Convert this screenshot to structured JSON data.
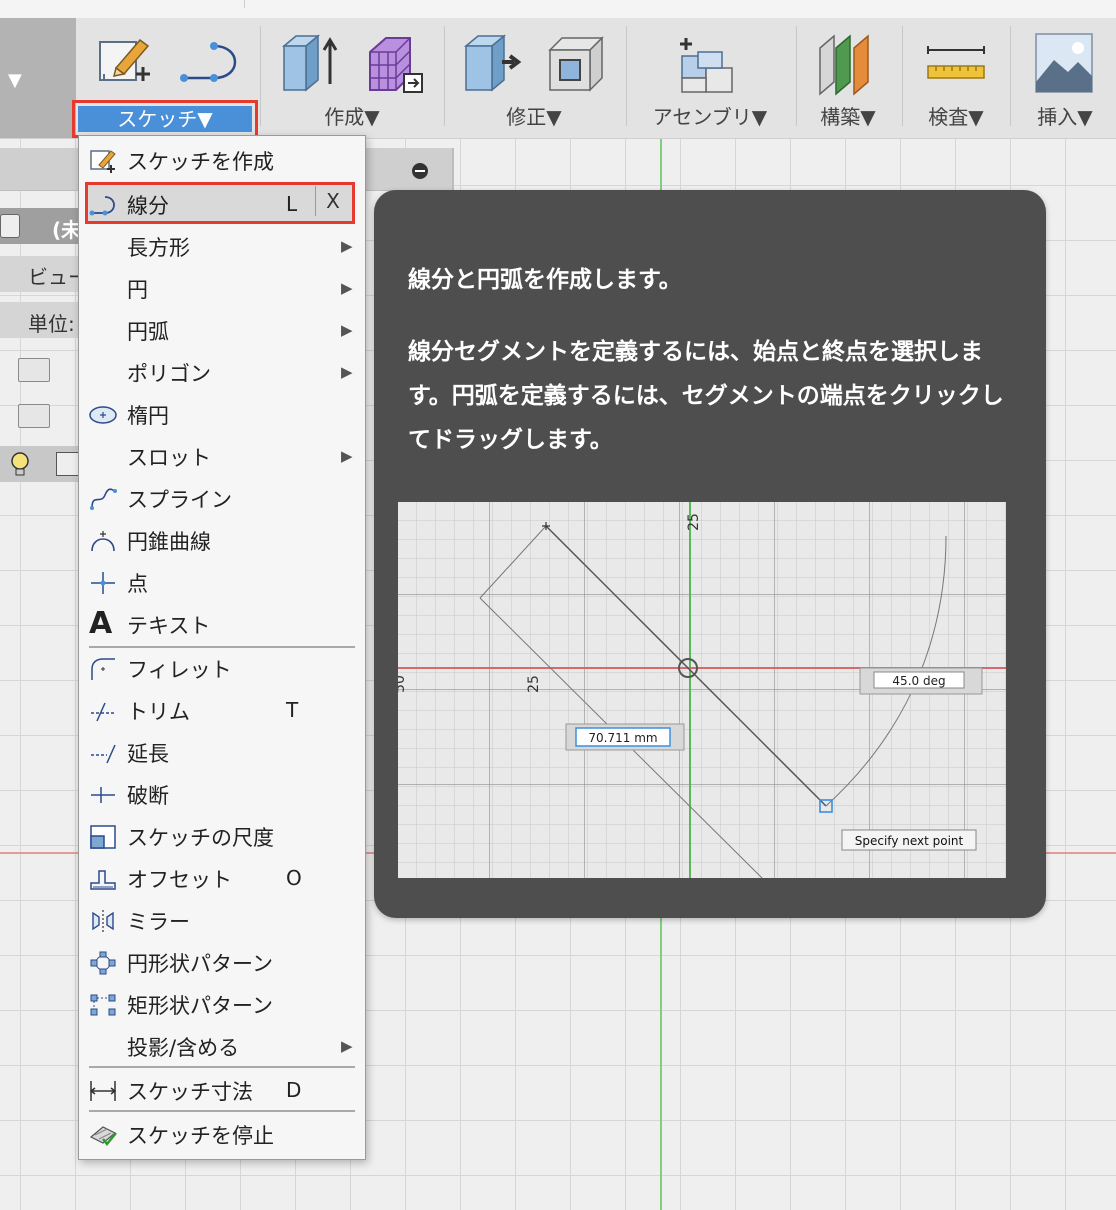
{
  "toolbar": {
    "groups": [
      {
        "label": "スケッチ▼"
      },
      {
        "label": "作成▼"
      },
      {
        "label": "修正▼"
      },
      {
        "label": "アセンブリ▼"
      },
      {
        "label": "構築▼"
      },
      {
        "label": "検査▼"
      },
      {
        "label": "挿入▼"
      }
    ]
  },
  "browser": {
    "rows": [
      "(未",
      "ビュー",
      "単位:"
    ]
  },
  "menu": {
    "items": [
      {
        "label": "スケッチを作成",
        "icon": "create-sketch-icon"
      },
      {
        "label": "線分",
        "shortcut": "L",
        "icon": "line-icon",
        "close": "X"
      },
      {
        "label": "長方形",
        "submenu": "▶"
      },
      {
        "label": "円",
        "submenu": "▶"
      },
      {
        "label": "円弧",
        "submenu": "▶"
      },
      {
        "label": "ポリゴン",
        "submenu": "▶"
      },
      {
        "label": "楕円",
        "icon": "ellipse-icon"
      },
      {
        "label": "スロット",
        "submenu": "▶"
      },
      {
        "label": "スプライン",
        "icon": "spline-icon"
      },
      {
        "label": "円錐曲線",
        "icon": "conic-curve-icon"
      },
      {
        "label": "点",
        "icon": "point-icon"
      },
      {
        "label": "テキスト",
        "icon": "text-icon"
      },
      {
        "label": "フィレット",
        "icon": "fillet-icon"
      },
      {
        "label": "トリム",
        "shortcut": "T",
        "icon": "trim-icon"
      },
      {
        "label": "延長",
        "icon": "extend-icon"
      },
      {
        "label": "破断",
        "icon": "break-icon"
      },
      {
        "label": "スケッチの尺度",
        "icon": "sketch-scale-icon"
      },
      {
        "label": "オフセット",
        "shortcut": "O",
        "icon": "offset-icon"
      },
      {
        "label": "ミラー",
        "icon": "mirror-icon"
      },
      {
        "label": "円形状パターン",
        "icon": "circular-pattern-icon"
      },
      {
        "label": "矩形状パターン",
        "icon": "rectangular-pattern-icon"
      },
      {
        "label": "投影/含める",
        "submenu": "▶"
      },
      {
        "label": "スケッチ寸法",
        "shortcut": "D",
        "icon": "sketch-dimension-icon"
      },
      {
        "label": "スケッチを停止",
        "icon": "stop-sketch-icon"
      }
    ]
  },
  "tooltip": {
    "title": "線分と円弧を作成します。",
    "body": "線分セグメントを定義するには、始点と終点を選択します。円弧を定義するには、セグメントの端点をクリックしてドラッグします。",
    "preview": {
      "axis_label_top": "25",
      "axis_label_left": "25",
      "axis_label_edge": "50",
      "length_field": "70.711 mm",
      "angle_field": "45.0 deg",
      "hint": "Specify next point"
    }
  }
}
